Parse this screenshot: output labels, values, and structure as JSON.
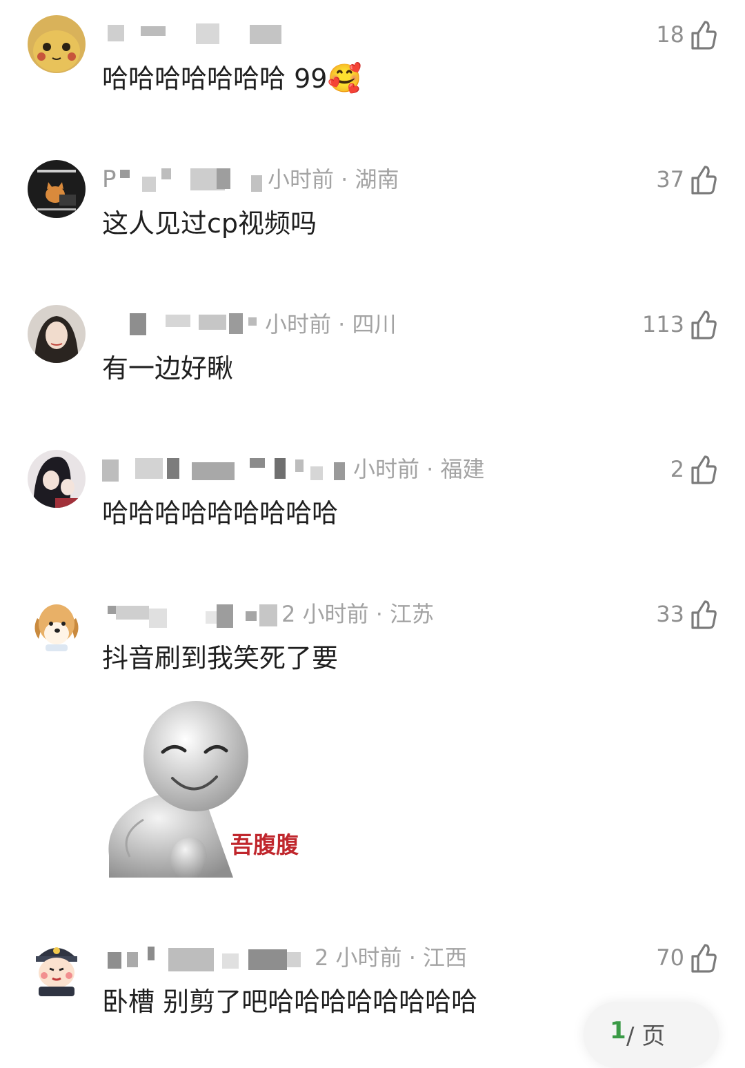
{
  "colors": {
    "text": "#1f1f1f",
    "meta": "#a3a3a3",
    "like": "#8f8f8f",
    "accent_page": "#3a9a46",
    "sticker_caption": "#c0272d"
  },
  "comments": [
    {
      "avatar": "pikachu-avatar",
      "name_prefix": "",
      "meta": "",
      "text": "哈哈哈哈哈哈哈 99",
      "emoji": "🥰",
      "likes": "18"
    },
    {
      "avatar": "cat-laptop-avatar",
      "name_prefix": "P",
      "meta": "小时前 · 湖南",
      "text": "这人见过cp视频吗",
      "likes": "37"
    },
    {
      "avatar": "girl-portrait-avatar",
      "name_prefix": "",
      "meta": "小时前 · 四川",
      "text": "有一边好瞅",
      "likes": "113"
    },
    {
      "avatar": "anime-couple-avatar",
      "name_prefix": "",
      "meta": "小时前 · 福建",
      "text": "哈哈哈哈哈哈哈哈哈",
      "likes": "2"
    },
    {
      "avatar": "dog-avatar",
      "name_prefix": "",
      "meta": "2 小时前 · 江苏",
      "text": "抖音刷到我笑死了要",
      "likes": "33",
      "sticker": {
        "caption": "吾腹腹"
      }
    },
    {
      "avatar": "police-avatar",
      "name_prefix": "",
      "meta": "2 小时前 · 江西",
      "text": "卧槽 别剪了吧哈哈哈哈哈哈哈哈",
      "likes": "70"
    }
  ],
  "pager": {
    "current": "1",
    "rest": "/  页"
  }
}
